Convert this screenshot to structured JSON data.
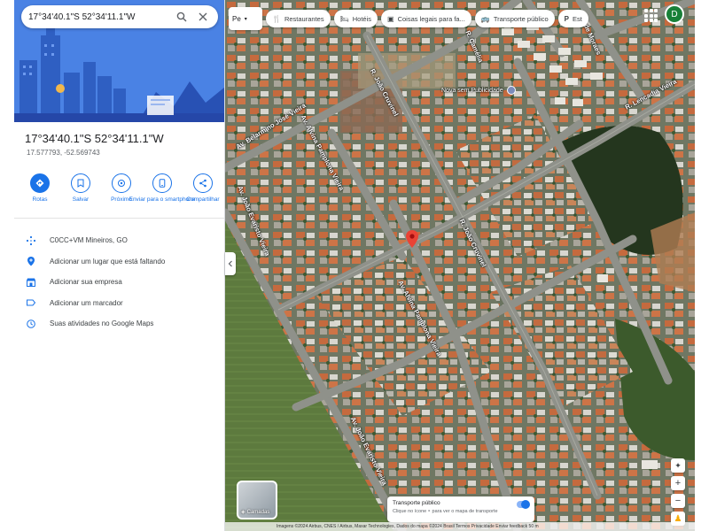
{
  "search": {
    "query": "17°34'40.1\"S 52°34'11.1\"W"
  },
  "place": {
    "title": "17°34'40.1\"S 52°34'11.1\"W",
    "decimal": "17.577793, -52.569743"
  },
  "actions": [
    {
      "label": "Rotas",
      "icon": "directions-icon"
    },
    {
      "label": "Salvar",
      "icon": "bookmark-icon"
    },
    {
      "label": "Próximo",
      "icon": "nearby-icon"
    },
    {
      "label": "Enviar para o smartphone",
      "icon": "send-to-phone-icon"
    },
    {
      "label": "Compartilhar",
      "icon": "share-icon"
    }
  ],
  "info": [
    {
      "text": "C0CC+VM Mineiros, GO",
      "icon": "plus-code-icon"
    },
    {
      "text": "Adicionar um lugar que está faltando",
      "icon": "add-place-icon"
    },
    {
      "text": "Adicionar sua empresa",
      "icon": "business-icon"
    },
    {
      "text": "Adicionar um marcador",
      "icon": "label-icon"
    },
    {
      "text": "Suas atividades no Google Maps",
      "icon": "history-icon"
    }
  ],
  "chips": [
    {
      "label": "Pe",
      "icon": "layer-icon"
    },
    {
      "label": "Restaurantes",
      "icon": "restaurant-icon"
    },
    {
      "label": "Hotéis",
      "icon": "hotel-icon"
    },
    {
      "label": "Coisas legais para fa...",
      "icon": "attractions-icon"
    },
    {
      "label": "Transporte público",
      "icon": "transit-icon"
    },
    {
      "label": "Est",
      "icon": "parking-icon"
    }
  ],
  "avatar": "D",
  "streets": [
    "Av. Belarmino José Vieira",
    "Av. Alvina Pamplona Vieira",
    "R. João Cruvinel",
    "R. Camélia",
    "R. Lencadia Vieira",
    "Av. João Evaristo Vieira",
    "R. João Cruvinel",
    "Av. Alvina Pamplona Vieira",
    "Av. João Evaristo Vieira",
    "de Moraes"
  ],
  "poi": "Nova sem Publicidade",
  "layers_label": "Camadas",
  "transit": {
    "title": "Transporte público",
    "subtitle": "Clique no ícone ‣ para ver o mapa de transporte"
  },
  "zoom": {
    "in": "+",
    "out": "−"
  },
  "footer": "Imagens ©2024 Airbus, CNES / Airbus, Maxar Technologies, Dados do mapa ©2024  Brasil  Termos  Privacidade  Enviar feedback  50 m"
}
